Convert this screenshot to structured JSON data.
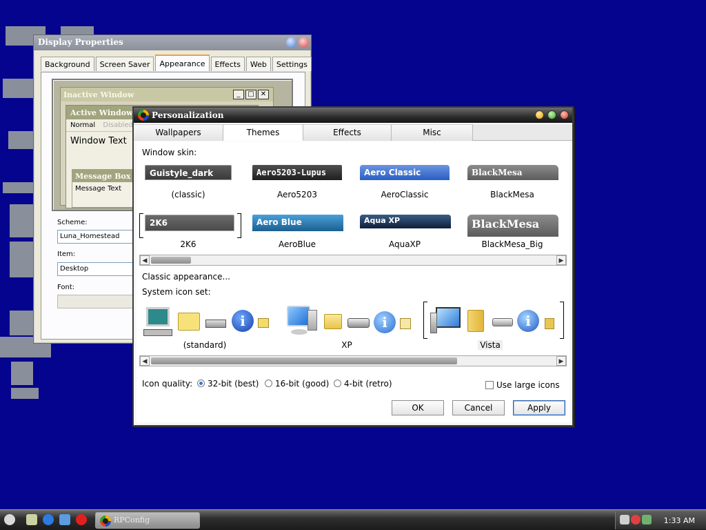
{
  "display_properties": {
    "title": "Display Properties",
    "tabs": [
      "Background",
      "Screen Saver",
      "Appearance",
      "Effects",
      "Web",
      "Settings"
    ],
    "active_tab": "Appearance",
    "preview": {
      "inactive_title": "Inactive Window",
      "active_title": "Active Window",
      "menu_normal": "Normal",
      "menu_disabled": "Disabled",
      "window_text": "Window Text",
      "message_box_title": "Message Box",
      "message_text": "Message Text"
    },
    "scheme_label": "Scheme:",
    "scheme_value": "Luna_Homestead",
    "item_label": "Item:",
    "item_value": "Desktop",
    "font_label": "Font:",
    "font_value": ""
  },
  "personalization": {
    "title": "Personalization",
    "tabs": [
      "Wallpapers",
      "Themes",
      "Effects",
      "Misc"
    ],
    "active_tab": "Themes",
    "window_skin_label": "Window skin:",
    "skins": [
      {
        "bar_text": "Guistyle_dark",
        "name": "(classic)"
      },
      {
        "bar_text": "Aero5203-Lupus",
        "name": "Aero5203"
      },
      {
        "bar_text": "Aero Classic",
        "name": "AeroClassic"
      },
      {
        "bar_text": "BlackMesa",
        "name": "BlackMesa"
      },
      {
        "bar_text": "2K6",
        "name": "2K6"
      },
      {
        "bar_text": "Aero Blue",
        "name": "AeroBlue"
      },
      {
        "bar_text": "Aqua XP",
        "name": "AquaXP"
      },
      {
        "bar_text": "BlackMesa",
        "name": "BlackMesa_Big"
      }
    ],
    "selected_skin": "2K6",
    "classic_appearance": "Classic appearance...",
    "icon_set_label": "System icon set:",
    "icon_sets": [
      "(standard)",
      "XP",
      "Vista"
    ],
    "selected_icon_set": "Vista",
    "icon_quality_label": "Icon quality:",
    "quality_options": [
      "32-bit (best)",
      "16-bit (good)",
      "4-bit (retro)"
    ],
    "selected_quality": "32-bit (best)",
    "large_icons_label": "Use large icons",
    "buttons": {
      "ok": "OK",
      "cancel": "Cancel",
      "apply": "Apply"
    }
  },
  "taskbar": {
    "task_label": "RPConfig",
    "clock": "1:33 AM"
  },
  "colors": {
    "desktop": "#04048e",
    "accent_select": "#2a7ad6"
  }
}
